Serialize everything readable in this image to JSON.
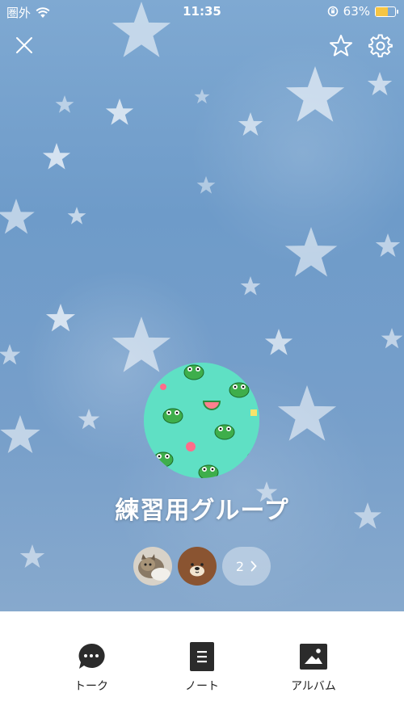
{
  "status_bar": {
    "carrier": "圏外",
    "time": "11:35",
    "battery_percent": "63%",
    "battery_level": 0.63
  },
  "header": {
    "close_icon": "close-icon",
    "favorite_icon": "star-icon",
    "settings_icon": "gear-icon"
  },
  "group": {
    "name": "練習用グループ",
    "member_count": "2"
  },
  "actions": [
    {
      "label": "トーク",
      "icon": "chat-icon"
    },
    {
      "label": "ノート",
      "icon": "note-icon"
    },
    {
      "label": "アルバム",
      "icon": "album-icon"
    }
  ],
  "colors": {
    "battery": "#f6c543",
    "avatar_bg": "#5fe0c4",
    "icon_dark": "#2b2b2b"
  }
}
